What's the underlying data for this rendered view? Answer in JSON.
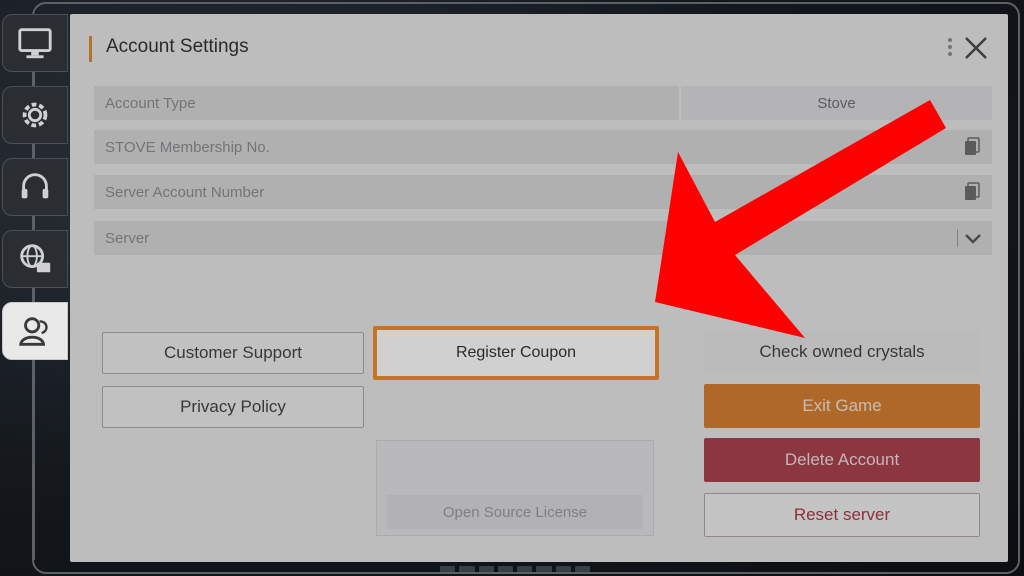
{
  "dialog": {
    "title": "Account Settings",
    "fields": [
      {
        "label": "Account Type",
        "value": "Stove"
      },
      {
        "label": "STOVE Membership No.",
        "value": ""
      },
      {
        "label": "Server Account Number",
        "value": ""
      },
      {
        "label": "Server",
        "value": ""
      }
    ]
  },
  "sidebar": {
    "tabs": [
      {
        "icon": "monitor-icon",
        "active": false
      },
      {
        "icon": "gear-icon",
        "active": false
      },
      {
        "icon": "headset-icon",
        "active": false
      },
      {
        "icon": "globe-chat-icon",
        "active": false
      },
      {
        "icon": "user-icon",
        "active": true
      }
    ]
  },
  "buttons": {
    "customer_support": "Customer Support",
    "privacy_policy": "Privacy Policy",
    "register_coupon": "Register Coupon",
    "open_source_license": "Open Source License",
    "check_crystals": "Check owned crystals",
    "exit_game": "Exit Game",
    "delete_account": "Delete Account",
    "reset_server": "Reset server"
  },
  "colors": {
    "highlight": "#f08a24",
    "exit": "#d67a2a",
    "delete": "#a83a48",
    "arrow": "#ff0000"
  }
}
